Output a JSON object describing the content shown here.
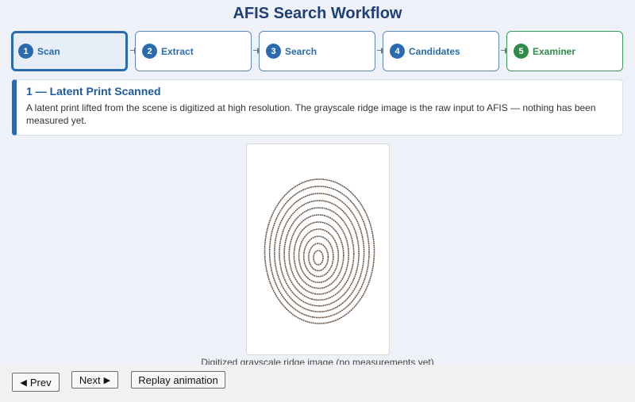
{
  "page": {
    "title": "AFIS Search Workflow"
  },
  "steps": [
    {
      "num": "1",
      "label": "Scan"
    },
    {
      "num": "2",
      "label": "Extract"
    },
    {
      "num": "3",
      "label": "Search"
    },
    {
      "num": "4",
      "label": "Candidates"
    },
    {
      "num": "5",
      "label": "Examiner"
    }
  ],
  "active_step": 1,
  "info": {
    "title": "1 — Latent Print Scanned",
    "description": "A latent print lifted from the scene is digitized at high resolution. The grayscale ridge image is the raw input to AFIS — nothing has been measured yet."
  },
  "figure": {
    "caption": "Digitized grayscale ridge image (no measurements yet)",
    "ridge_color": "#6b5a4e"
  },
  "controls": {
    "prev_label": "Prev",
    "next_label": "Next",
    "replay_label": "Replay animation"
  },
  "colors": {
    "accent": "#2a6bb0",
    "final_step": "#2e8b48",
    "title": "#1f3f78"
  },
  "icons": {
    "prev": "triangle-left-icon",
    "next": "triangle-right-icon"
  }
}
